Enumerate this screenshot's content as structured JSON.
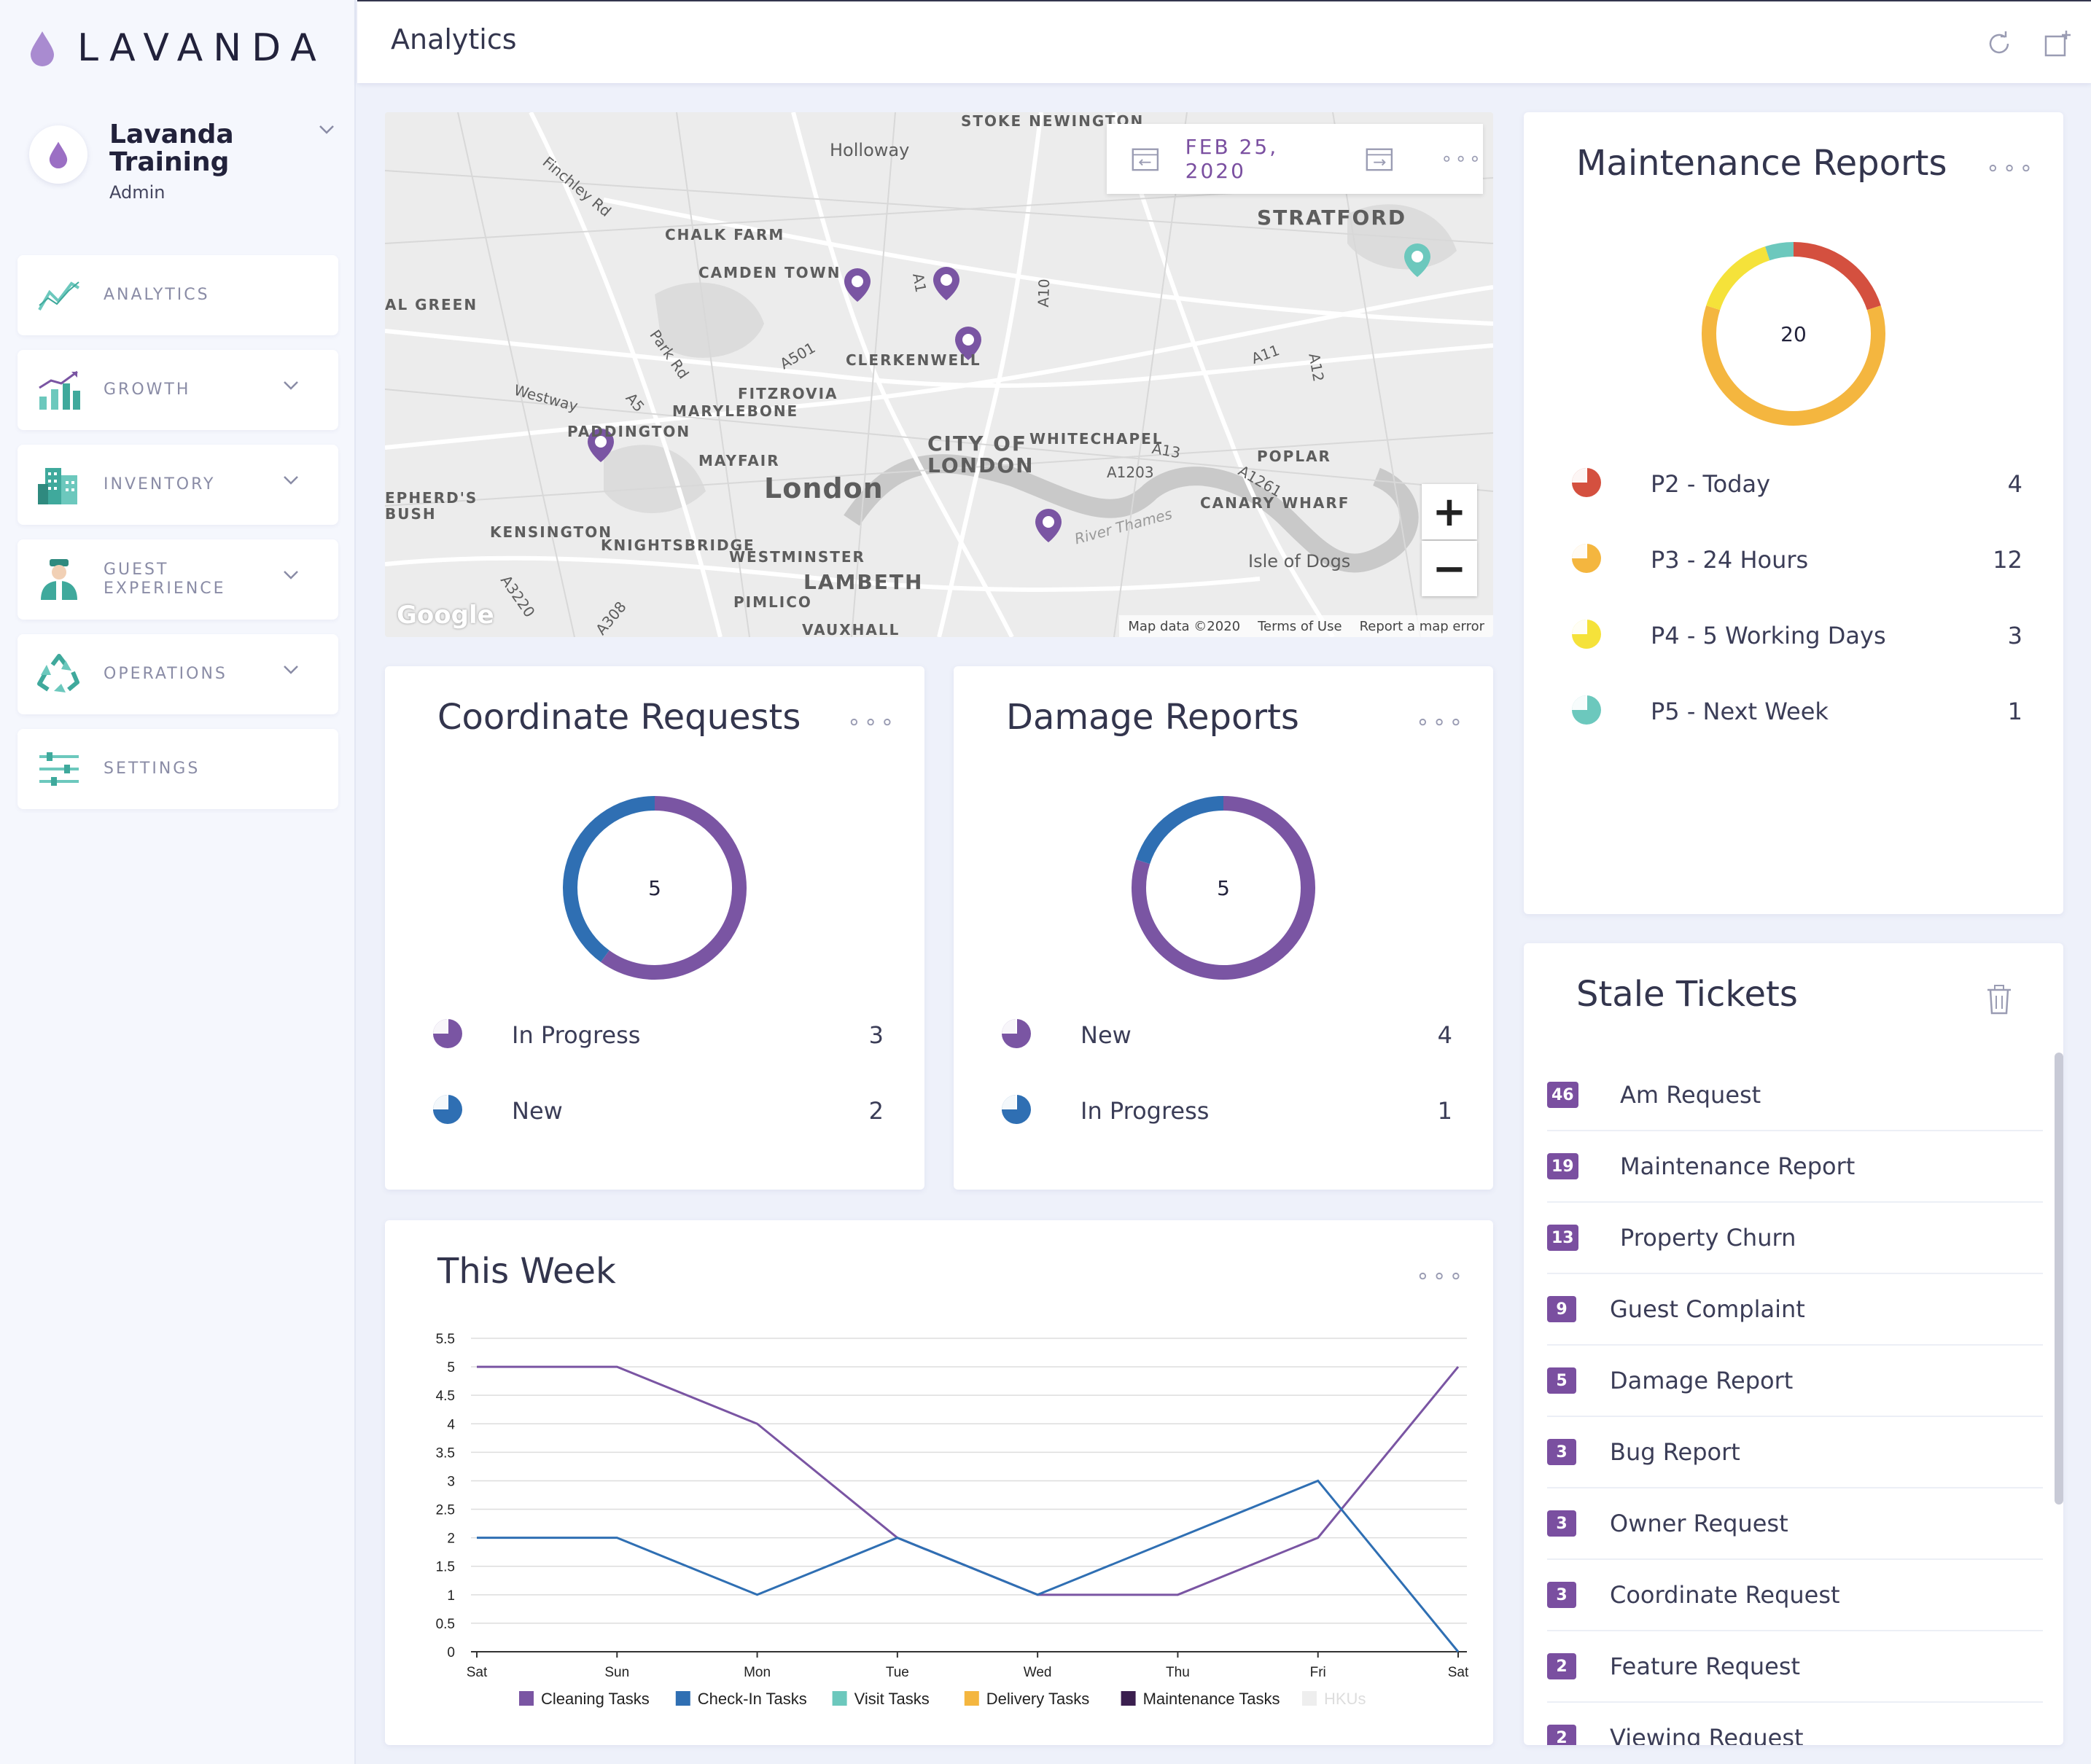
{
  "app": {
    "brand": "LAVANDA",
    "accent": "#7a4fa0"
  },
  "profile": {
    "name": "Lavanda Training",
    "role": "Admin"
  },
  "sidebar": {
    "items": [
      {
        "label": "ANALYTICS",
        "icon": "analytics-icon",
        "expandable": false
      },
      {
        "label": "GROWTH",
        "icon": "growth-icon",
        "expandable": true
      },
      {
        "label": "INVENTORY",
        "icon": "inventory-icon",
        "expandable": true
      },
      {
        "label": "GUEST EXPERIENCE",
        "icon": "guest-experience-icon",
        "expandable": true
      },
      {
        "label": "OPERATIONS",
        "icon": "recycle-icon",
        "expandable": true
      },
      {
        "label": "SETTINGS",
        "icon": "sliders-icon",
        "expandable": false
      }
    ]
  },
  "header": {
    "title": "Analytics"
  },
  "map": {
    "date": "FEB 25, 2020",
    "labels": [
      "STOKE NEWINGTON",
      "Holloway",
      "CHALK FARM",
      "CAMDEN TOWN",
      "STRATFORD",
      "AL GREEN",
      "CLERKENWELL",
      "FITZROVIA",
      "MARYLEBONE",
      "PADDINGTON",
      "MAYFAIR",
      "London",
      "CITY OF LONDON",
      "WHITECHAPEL",
      "POPLAR",
      "CANARY WHARF",
      "EPHERD'S BUSH",
      "KENSINGTON",
      "KNIGHTSBRIDGE",
      "WESTMINSTER",
      "LAMBETH",
      "PIMLICO",
      "Isle of Dogs",
      "VAUXHALL",
      "Finchley Rd",
      "Park Rd",
      "Westway",
      "A501",
      "A5",
      "A10",
      "A11",
      "A12",
      "A13",
      "A1203",
      "A1261",
      "A3220",
      "A308",
      "A1",
      "River Thames"
    ],
    "attribution": [
      "Map data ©2020",
      "Terms of Use",
      "Report a map error"
    ],
    "google": "Google",
    "zoom_in": "+",
    "zoom_out": "−"
  },
  "maintenance": {
    "title": "Maintenance Reports",
    "total": "20",
    "items": [
      {
        "label": "P2 - Today",
        "count": "4",
        "color": "#d4503f"
      },
      {
        "label": "P3 - 24 Hours",
        "count": "12",
        "color": "#f4b63f"
      },
      {
        "label": "P4 - 5 Working Days",
        "count": "3",
        "color": "#f5e23a"
      },
      {
        "label": "P5 - Next Week",
        "count": "1",
        "color": "#6cc8bd"
      }
    ]
  },
  "coordinate": {
    "title": "Coordinate Requests",
    "total": "5",
    "items": [
      {
        "label": "In Progress",
        "count": "3",
        "color": "#7a55a3"
      },
      {
        "label": "New",
        "count": "2",
        "color": "#2f6fb3"
      }
    ]
  },
  "damage": {
    "title": "Damage Reports",
    "total": "5",
    "items": [
      {
        "label": "New",
        "count": "4",
        "color": "#7a55a3"
      },
      {
        "label": "In Progress",
        "count": "1",
        "color": "#2f6fb3"
      }
    ]
  },
  "stale": {
    "title": "Stale Tickets",
    "items": [
      {
        "count": "46",
        "label": "Am Request"
      },
      {
        "count": "19",
        "label": "Maintenance Report"
      },
      {
        "count": "13",
        "label": "Property Churn"
      },
      {
        "count": "9",
        "label": "Guest Complaint"
      },
      {
        "count": "5",
        "label": "Damage Report"
      },
      {
        "count": "3",
        "label": "Bug Report"
      },
      {
        "count": "3",
        "label": "Owner Request"
      },
      {
        "count": "3",
        "label": "Coordinate Request"
      },
      {
        "count": "2",
        "label": "Feature Request"
      },
      {
        "count": "2",
        "label": "Viewing Request"
      }
    ]
  },
  "week": {
    "title": "This Week"
  },
  "chart_data": {
    "type": "line",
    "categories": [
      "Sat",
      "Sun",
      "Mon",
      "Tue",
      "Wed",
      "Thu",
      "Fri",
      "Sat"
    ],
    "ylim": [
      0,
      5.5
    ],
    "yticks": [
      "0",
      "0.5",
      "1",
      "1.5",
      "2",
      "2.5",
      "3",
      "3.5",
      "4",
      "4.5",
      "5",
      "5.5"
    ],
    "series": [
      {
        "name": "Cleaning Tasks",
        "color": "#7a55a3",
        "values": [
          5,
          5,
          4,
          2,
          1,
          1,
          2,
          5
        ]
      },
      {
        "name": "Check-In Tasks",
        "color": "#2f6fb3",
        "values": [
          2,
          2,
          1,
          2,
          1,
          2,
          3,
          0
        ]
      },
      {
        "name": "Visit Tasks",
        "color": "#6cc8bd",
        "values": []
      },
      {
        "name": "Delivery Tasks",
        "color": "#f4b63f",
        "values": []
      },
      {
        "name": "Maintenance Tasks",
        "color": "#3b1f4f",
        "values": []
      },
      {
        "name": "HKUs",
        "color": "#eeeeee",
        "values": []
      }
    ],
    "legend": "bottom",
    "grid": true
  }
}
